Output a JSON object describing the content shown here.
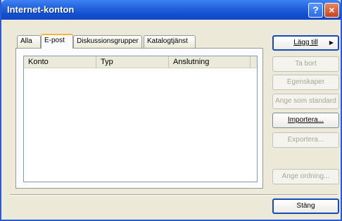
{
  "window": {
    "title": "Internet-konton"
  },
  "titlebar": {
    "help_label": "?",
    "close_label": "×"
  },
  "tabs": [
    {
      "label": "Alla"
    },
    {
      "label": "E-post"
    },
    {
      "label": "Diskussionsgrupper"
    },
    {
      "label": "Katalogtjänst"
    }
  ],
  "list": {
    "columns": [
      "Konto",
      "Typ",
      "Anslutning"
    ]
  },
  "buttons": {
    "add": "Lägg till",
    "remove": "Ta bort",
    "properties": "Egenskaper",
    "set_default": "Ange som standard",
    "import": "Importera...",
    "export": "Exportera...",
    "set_order": "Ange ordning...",
    "close": "Stäng"
  },
  "icons": {
    "add_menu_arrow": "arrow-right-icon"
  }
}
